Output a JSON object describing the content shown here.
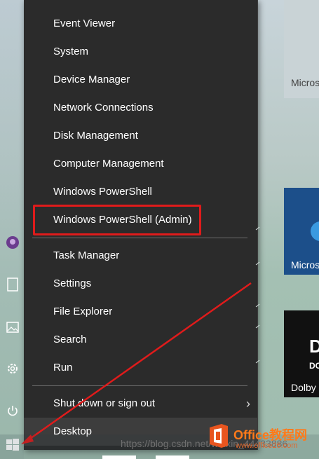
{
  "menu": {
    "items": [
      {
        "label": "Event Viewer"
      },
      {
        "label": "System"
      },
      {
        "label": "Device Manager"
      },
      {
        "label": "Network Connections"
      },
      {
        "label": "Disk Management"
      },
      {
        "label": "Computer Management"
      },
      {
        "label": "Windows PowerShell"
      },
      {
        "label": "Windows PowerShell (Admin)"
      },
      {
        "label": "Task Manager"
      },
      {
        "label": "Settings"
      },
      {
        "label": "File Explorer"
      },
      {
        "label": "Search"
      },
      {
        "label": "Run"
      },
      {
        "label": "Shut down or sign out"
      },
      {
        "label": "Desktop"
      }
    ]
  },
  "tiles": [
    {
      "label": "Micros"
    },
    {
      "label": "Micros"
    },
    {
      "label": "Dolby"
    }
  ],
  "dolby_glyph": "D",
  "dolby_sub": "DO",
  "watermark": "https://blog.csdn.net/weixin_44433886",
  "office_brand": {
    "name": "Office教程网",
    "url": "www.office26.com"
  },
  "colors": {
    "menu_bg": "#2b2b2b",
    "highlight_box": "#e01b1b",
    "arrow": "#e01b1b",
    "tile_blue": "#1c4f8a"
  },
  "icons": [
    "windows-start-icon",
    "power-icon",
    "settings-icon",
    "pictures-icon",
    "document-icon",
    "user-avatar-icon",
    "chevron-right-icon",
    "office-logo-icon"
  ]
}
